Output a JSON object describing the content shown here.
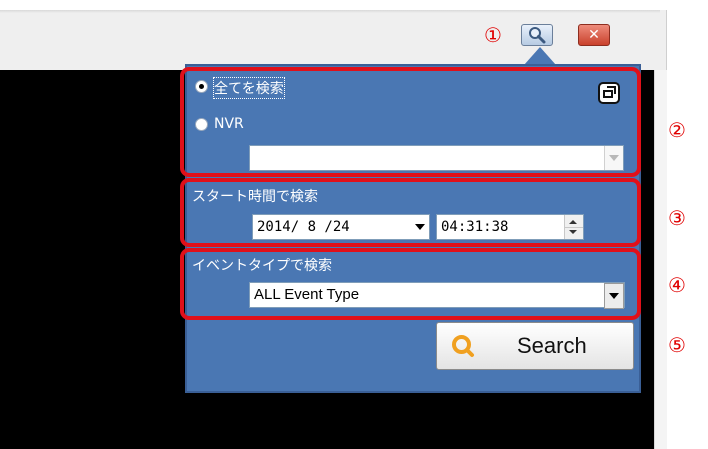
{
  "panel": {
    "search_all_label": "全てを検索",
    "nvr_label": "NVR",
    "nvr_select_value": "",
    "start_time_label": "スタート時間で検索",
    "date_value": "2014/ 8 /24",
    "time_value": "04:31:38",
    "event_type_label": "イベントタイプで検索",
    "event_type_value": "ALL Event Type",
    "search_button_label": "Search"
  },
  "callouts": [
    "①",
    "②",
    "③",
    "④",
    "⑤"
  ],
  "colors": {
    "panel_bg": "#4a77b3",
    "highlight": "#e0101a",
    "video_bg": "#000000",
    "search_icon_accent": "#f0a020"
  },
  "icons": [
    "magnifier-icon",
    "close-icon",
    "restore-icon",
    "chevron-down-icon",
    "spinner-icon",
    "search-icon"
  ]
}
